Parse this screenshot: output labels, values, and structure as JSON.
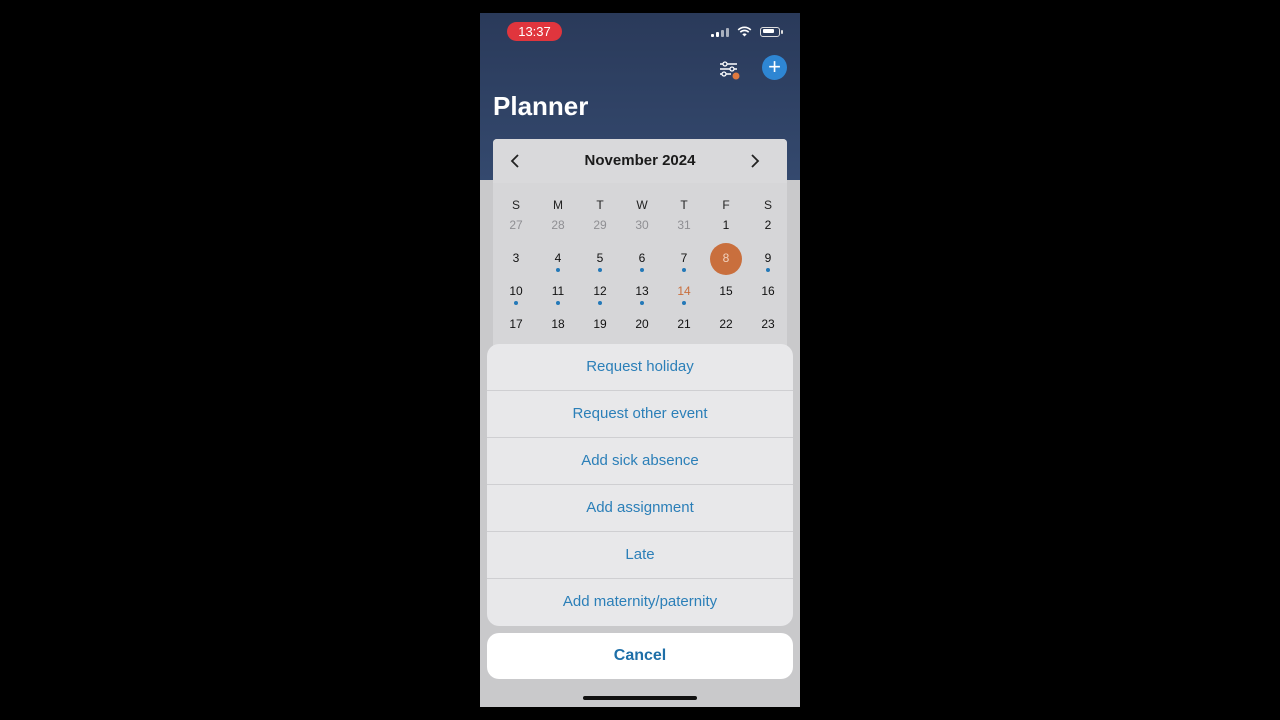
{
  "status_bar": {
    "time": "13:37"
  },
  "header": {
    "title": "Planner"
  },
  "calendar": {
    "month_label": "November 2024",
    "weekdays": [
      "S",
      "M",
      "T",
      "W",
      "T",
      "F",
      "S"
    ],
    "rows": [
      [
        {
          "n": "27",
          "muted": true
        },
        {
          "n": "28",
          "muted": true
        },
        {
          "n": "29",
          "muted": true
        },
        {
          "n": "30",
          "muted": true
        },
        {
          "n": "31",
          "muted": true
        },
        {
          "n": "1"
        },
        {
          "n": "2"
        }
      ],
      [
        {
          "n": "3"
        },
        {
          "n": "4",
          "dot": true
        },
        {
          "n": "5",
          "dot": true
        },
        {
          "n": "6",
          "dot": true
        },
        {
          "n": "7",
          "dot": true
        },
        {
          "n": "8",
          "selected": true
        },
        {
          "n": "9",
          "dot": true
        }
      ],
      [
        {
          "n": "10",
          "dot": true
        },
        {
          "n": "11",
          "dot": true
        },
        {
          "n": "12",
          "dot": true
        },
        {
          "n": "13",
          "dot": true
        },
        {
          "n": "14",
          "dot": true,
          "accent": true
        },
        {
          "n": "15"
        },
        {
          "n": "16"
        }
      ],
      [
        {
          "n": "17"
        },
        {
          "n": "18"
        },
        {
          "n": "19"
        },
        {
          "n": "20"
        },
        {
          "n": "21"
        },
        {
          "n": "22"
        },
        {
          "n": "23"
        }
      ]
    ]
  },
  "action_sheet": {
    "items": [
      "Request holiday",
      "Request other event",
      "Add sick absence",
      "Add assignment",
      "Late",
      "Add maternity/paternity"
    ],
    "cancel_label": "Cancel"
  },
  "colors": {
    "header": "#2a3a5a",
    "accent_blue": "#2b7fb8",
    "selected_day": "#c96f3d",
    "time_pill": "#e0353d"
  }
}
